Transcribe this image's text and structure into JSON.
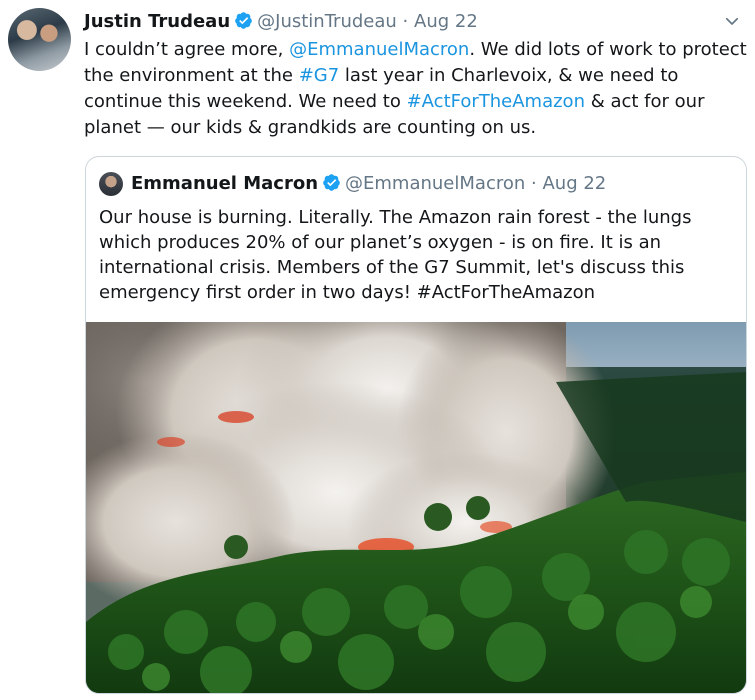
{
  "tweet": {
    "author_name": "Justin Trudeau",
    "handle": "@JustinTrudeau",
    "separator": "·",
    "date": "Aug 22",
    "text_parts": [
      {
        "t": "I couldn’t agree more, ",
        "link": false
      },
      {
        "t": "@EmmanuelMacron",
        "link": true
      },
      {
        "t": ". We did lots of work to protect the environment at the ",
        "link": false
      },
      {
        "t": "#G7",
        "link": true
      },
      {
        "t": " last year in Charlevoix, & we need to continue this weekend. We need to ",
        "link": false
      },
      {
        "t": "#ActForTheAmazon",
        "link": true
      },
      {
        "t": " & act for our planet — our kids & grandkids are counting on us.",
        "link": false
      }
    ]
  },
  "quoted": {
    "author_name": "Emmanuel Macron",
    "handle": "@EmmanuelMacron",
    "separator": "·",
    "date": "Aug 22",
    "text": "Our house is burning. Literally. The Amazon rain forest - the lungs which produces 20% of our planet’s oxygen - is on fire. It is an international crisis. Members of the G7 Summit, let's discuss this emergency first order in two days! #ActForTheAmazon"
  },
  "colors": {
    "link": "#1b95e0",
    "verified": "#1da1f2",
    "muted": "#657786"
  },
  "icons": {
    "verified": "verified-badge-icon",
    "menu": "chevron-down-icon"
  }
}
